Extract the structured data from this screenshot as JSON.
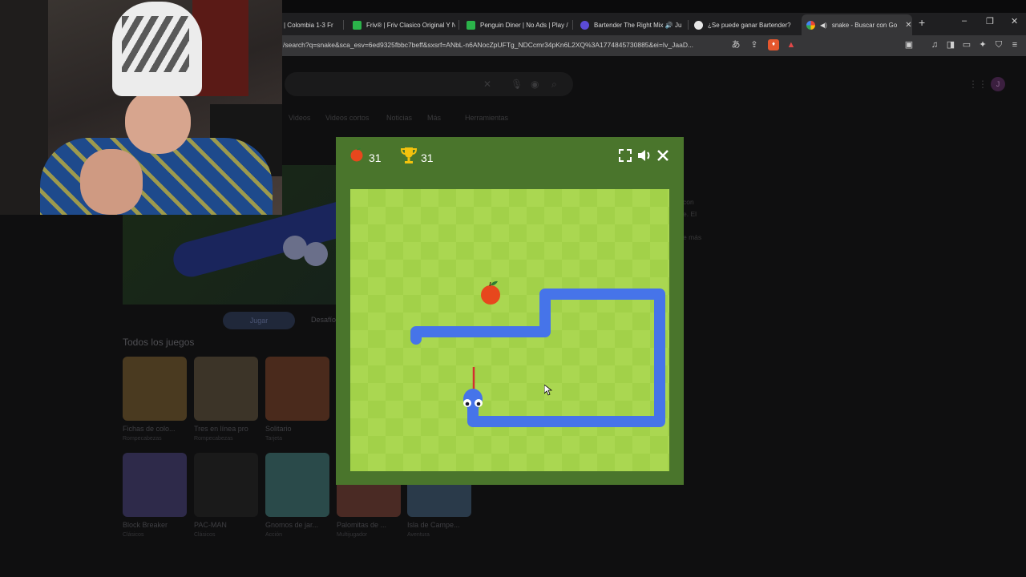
{
  "browser": {
    "tabs": [
      {
        "title": "| Colombia 1-3 Fr",
        "favicon_color": "#3a3a3a"
      },
      {
        "title": "Friv® | Friv Clasico Original Y N",
        "favicon_color": "#2bb34a"
      },
      {
        "title": "Penguin Diner | No Ads | Play /",
        "favicon_color": "#2bb34a"
      },
      {
        "title": "Bartender The Right Mix 🔊 Ju",
        "favicon_color": "#5b4bd6"
      },
      {
        "title": "¿Se puede ganar Bartender?",
        "favicon_color": "#e6e6e6"
      },
      {
        "title": "snake - Buscar con Go",
        "favicon_color": "#ffffff"
      }
    ],
    "url": "/search?q=snake&sca_esv=6ed9325fbbc7beff&sxsrf=ANbL-n6ANocZpUFTg_NDCcmr34pKn6L2XQ%3A1774845730885&ei=Iv_JaaD...",
    "new_tab": "+",
    "window_controls": [
      "–",
      "❐",
      "✕"
    ]
  },
  "search": {
    "filters": [
      "Videos",
      "Videos cortos",
      "Noticias",
      "Más",
      "Herramientas"
    ],
    "side_text": [
      "con",
      "e. El",
      "",
      "e más"
    ],
    "avatar": "J",
    "play_button": "Jugar",
    "challenge": "Desafío",
    "games_heading": "Todos los juegos",
    "games": [
      {
        "title": "Fichas de colo...",
        "category": "Rompecabezas",
        "color": "#4a3a20"
      },
      {
        "title": "Tres en línea pro",
        "category": "Rompecabezas",
        "color": "#3c3428"
      },
      {
        "title": "Solitario",
        "category": "Tarjeta",
        "color": "#4a2a1c"
      },
      {
        "title": "Block Breaker",
        "category": "Clásicos",
        "color": "#2e2a4a"
      },
      {
        "title": "PAC-MAN",
        "category": "Clásicos",
        "color": "#1a1a1a"
      },
      {
        "title": "Gnomos de jar...",
        "category": "Acción",
        "color": "#2a4a4a"
      },
      {
        "title": "Palomitas de ...",
        "category": "Multijugador",
        "color": "#4a2a24"
      },
      {
        "title": "Isla de Campe...",
        "category": "Aventura",
        "color": "#2a3a4a"
      }
    ]
  },
  "snake_game": {
    "score": "31",
    "high_score": "31",
    "colors": {
      "header": "#4a752c",
      "board_light": "#aad751",
      "board_dark": "#a2d149",
      "snake": "#4674e9",
      "apple": "#e7471d"
    }
  }
}
